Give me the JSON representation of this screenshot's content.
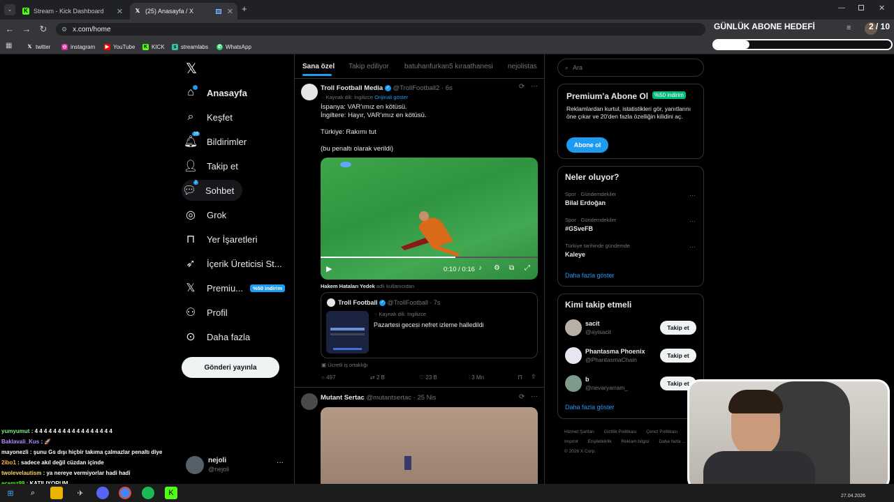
{
  "tabs": [
    {
      "label": "Stream - Kick Dashboard",
      "icon": "kick-icon"
    },
    {
      "label": "(25) Anasayfa / X",
      "icon": "x-icon"
    }
  ],
  "address": {
    "url": "x.com/home"
  },
  "bookmarks": [
    "twitter",
    "instagram",
    "YouTube",
    "KICK",
    "streamlabs",
    "WhatsApp"
  ],
  "overlay": {
    "goal_title": "GÜNLÜK ABONE HEDEFİ",
    "goal_count": "2 / 10",
    "goal_progress": 0.2
  },
  "sidebar": {
    "items": [
      {
        "label": "Anasayfa",
        "icon": "home-icon"
      },
      {
        "label": "Keşfet",
        "icon": "search-icon"
      },
      {
        "label": "Bildirimler",
        "icon": "bell-icon",
        "badge": "18"
      },
      {
        "label": "Takip et",
        "icon": "add-user-icon"
      },
      {
        "label": "Sohbet",
        "icon": "chat-icon",
        "badge": "7"
      },
      {
        "label": "Grok",
        "icon": "grok-icon"
      },
      {
        "label": "Yer İşaretleri",
        "icon": "bookmark-icon"
      },
      {
        "label": "İçerik Üreticisi St...",
        "icon": "rocket-icon"
      },
      {
        "label": "Premiu...",
        "icon": "x-icon",
        "tag": "%50 indirim"
      },
      {
        "label": "Profil",
        "icon": "person-icon"
      },
      {
        "label": "Daha fazla",
        "icon": "more-circle-icon"
      }
    ],
    "post_button": "Gönderi yayınla",
    "account": {
      "name": "nejoli",
      "handle": "@nejoli",
      "more": "···"
    }
  },
  "feed": {
    "tabs": [
      "Sana özel",
      "Takip ediliyor",
      "batuhanfurkan5 kıraathanesi",
      "nejolistas"
    ],
    "tweet1": {
      "author": "Troll Football Media",
      "handle": "@TrollFootball2",
      "time": "· 6s",
      "translated": "Kaynak dili: İngilizce",
      "original": "Orijinali göster",
      "lines": [
        "İspanya: VAR'ımız en kötüsü.",
        "İngiltere: Hayır, VAR'ımız en kötüsü.",
        "",
        "Türkiye: Rakımı tut",
        "",
        "(bu penaltı olarak verildi)"
      ],
      "video_time": "0:10 / 0:16",
      "video_progress": 0.62,
      "credit_name": "Hakem Hataları Yedek",
      "credit_suffix": "adlı kullanıcıdan",
      "quote": {
        "author": "Troll Football",
        "handle": "@TrollFootball",
        "time": "· 7s",
        "translated": "Kaynak dili: İngilizce",
        "text": "Pazartesi gecesi nefret izleme halledildi"
      },
      "paid": "Ücretli iş ortaklığı",
      "stats": {
        "replies": "497",
        "retweets": "2 B",
        "likes": "23 B",
        "views": "3 Mn"
      }
    },
    "tweet2": {
      "author": "Mutant Sertac",
      "handle": "@mutantsertac",
      "time": "· 25 Nis"
    }
  },
  "right": {
    "search_placeholder": "Ara",
    "premium": {
      "title": "Premium'a Abone Ol",
      "tag": "%50 indirim",
      "desc": "Reklamlardan kurtul, istatistikleri gör, yanıtlarını öne çıkar ve 20'den fazla özelliğin kilidini aç.",
      "button": "Abone ol"
    },
    "trends": {
      "title": "Neler oluyor?",
      "items": [
        {
          "cat": "Spor · Gündemdekiler",
          "name": "Bilal Erdoğan"
        },
        {
          "cat": "Spor · Gündemdekiler",
          "name": "#GSveFB"
        },
        {
          "cat": "Türkiye tarihinde gündemde",
          "name": "Kaleye"
        }
      ],
      "more": "Daha fazla göster"
    },
    "follow": {
      "title": "Kimi takip etmeli",
      "items": [
        {
          "name": "sacit",
          "handle": "@ayisacit",
          "button": "Takip et"
        },
        {
          "name": "Phantasma Phoenix",
          "handle": "@PhantasmaChain",
          "button": "Takip et"
        },
        {
          "name": "b",
          "handle": "@nevaryarram_",
          "button": "Takip et"
        }
      ],
      "more": "Daha fazla göster"
    },
    "footer": [
      "Hizmet Şartları",
      "Gizlilik Politikası",
      "Çerez Politikası",
      "Imprint",
      "Erişilebilirlik",
      "Reklam bilgisi",
      "Daha fazla ...",
      "© 2026 X Corp."
    ]
  },
  "chat": [
    {
      "user": "yumyumut",
      "msg": ": 4 4 4 4 4 4 4 4 4 4 4 4 4 4 4 4 4",
      "color": "#7cf08a"
    },
    {
      "user": "Baklavali_Kus",
      "msg": ": 🚀",
      "color": "#b38cff"
    },
    {
      "user": "mayonezli",
      "msg": ": şunu Gs dışı hiçbir takıma çalmazlar penaltı diye",
      "color": "#ffffff"
    },
    {
      "user": "2ibo1",
      "msg": ": sadece akıl değil cüzdan içinde",
      "color": "#ffb347"
    },
    {
      "user": "twolevelautism",
      "msg": ": ya nereye vermiyorlar hadi hadi",
      "color": "#ffd36b"
    },
    {
      "user": "ecemz99",
      "msg": ": KATILIYORUM",
      "color": "#53fc18"
    }
  ],
  "taskbar": {
    "date": "27.04.2026"
  }
}
